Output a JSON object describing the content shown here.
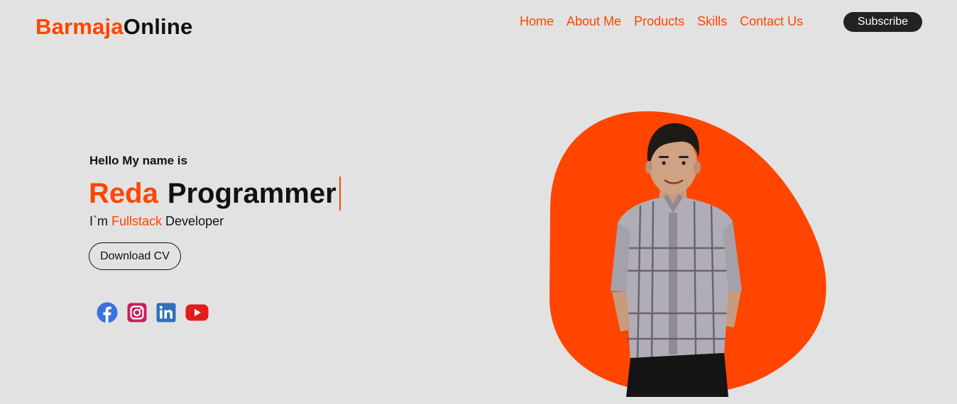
{
  "header": {
    "logo_accent": "Barmaja",
    "logo_rest": "Online",
    "nav": [
      "Home",
      "About Me",
      "Products",
      "Skills",
      "Contact Us"
    ],
    "subscribe_label": "Subscribe"
  },
  "hero": {
    "greeting": "Hello My name is",
    "name": "Reda",
    "title": "Programmer",
    "role_prefix": "I`m",
    "role_highlight": "Fullstack",
    "role_suffix": "Developer",
    "download_label": "Download CV",
    "socials": [
      "facebook-icon",
      "instagram-icon",
      "linkedin-icon",
      "youtube-icon"
    ]
  },
  "colors": {
    "accent": "#ff4500",
    "background": "#e2e2e2",
    "dark": "#222222",
    "facebook": "#3b71e0",
    "instagram": "#c91f5d",
    "linkedin": "#3271b8",
    "youtube": "#e21b1b"
  }
}
